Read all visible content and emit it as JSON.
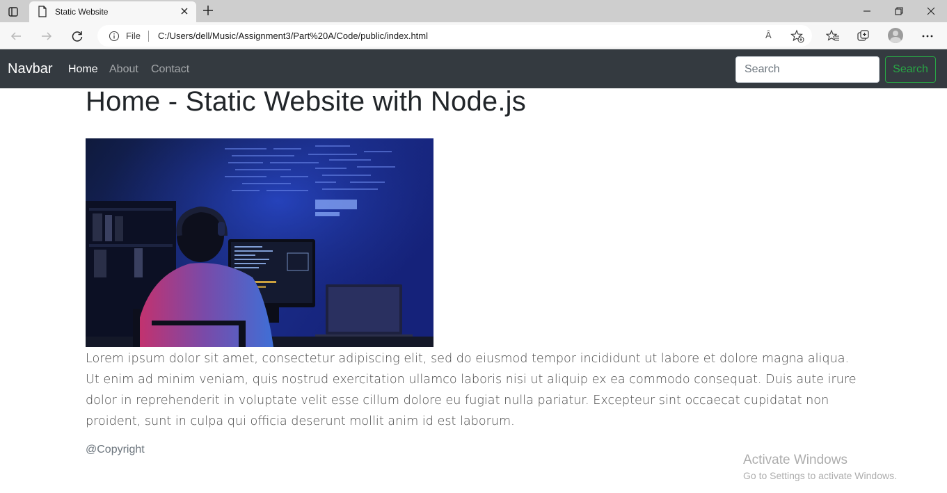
{
  "browser": {
    "tab_title": "Static Website",
    "address": {
      "scheme_label": "File",
      "url": "C:/Users/dell/Music/Assignment3/Part%20A/Code/public/index.html",
      "read_aloud": "Ȃ"
    }
  },
  "navbar": {
    "brand": "Navbar",
    "links": [
      {
        "label": "Home",
        "active": true
      },
      {
        "label": "About",
        "active": false
      },
      {
        "label": "Contact",
        "active": false
      }
    ],
    "search_placeholder": "Search",
    "search_button": "Search"
  },
  "main": {
    "heading": "Home - Static Website with Node.js",
    "paragraph": "Lorem ipsum dolor sit amet, consectetur adipiscing elit, sed do eiusmod tempor incididunt ut labore et dolore magna aliqua. Ut enim ad minim veniam, quis nostrud exercitation ullamco laboris nisi ut aliquip ex ea commodo consequat. Duis aute irure dolor in reprehenderit in voluptate velit esse cillum dolore eu fugiat nulla pariatur. Excepteur sint occaecat cupidatat non proident, sunt in culpa qui officia deserunt mollit anim id est laborum.",
    "footer": "@Copyright"
  },
  "watermark": {
    "line1": "Activate Windows",
    "line2": "Go to Settings to activate Windows."
  },
  "colors": {
    "navbar_bg": "#343a40",
    "success": "#28a745"
  }
}
